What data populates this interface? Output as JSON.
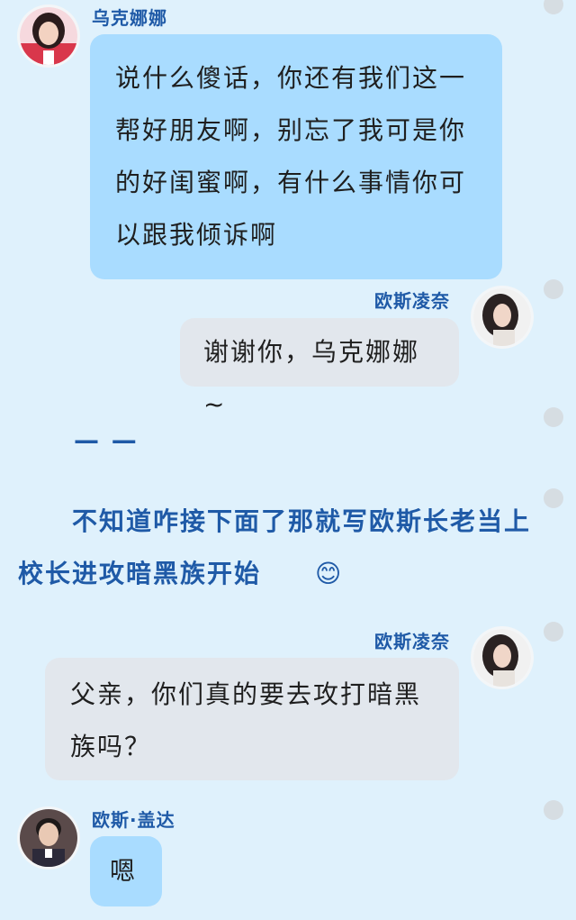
{
  "messages": [
    {
      "sender": "乌克娜娜",
      "text": "说什么傻话，你还有我们这一帮好朋友啊，别忘了我可是你的好闺蜜啊，有什么事情你可以跟我倾诉啊"
    },
    {
      "sender": "欧斯凌奈",
      "text": "谢谢你，乌克娜娜~"
    },
    {
      "sender": "欧斯凌奈",
      "text": "父亲，你们真的要去攻打暗黑族吗？"
    },
    {
      "sender": "欧斯·盖达",
      "text": "嗯"
    }
  ],
  "narration": {
    "dashes": "— —",
    "line": "不知道咋接下面了那就写欧斯长老当上校长进攻暗黑族开始",
    "emoji": "😊"
  },
  "colors": {
    "background": "#dff1fc",
    "left_bubble": "#a9dcff",
    "right_bubble": "#e2e7ed",
    "name": "#1f5aa7"
  }
}
